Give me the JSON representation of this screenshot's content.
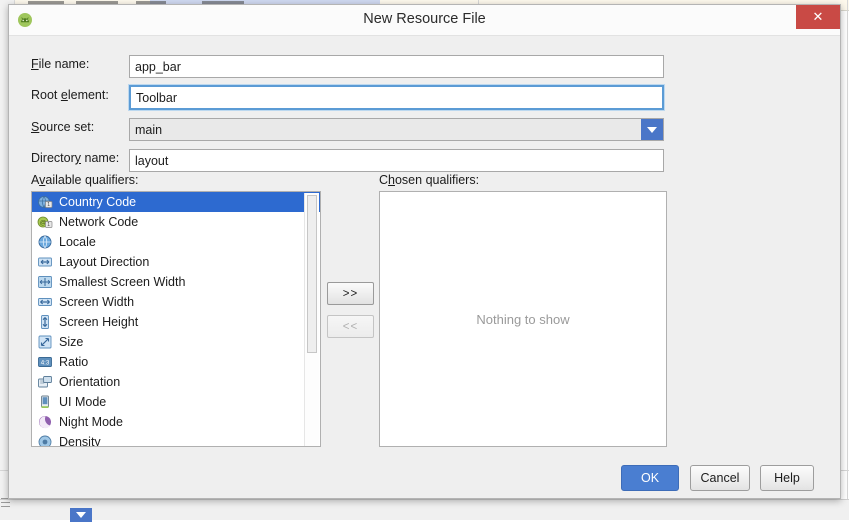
{
  "dialog": {
    "title": "New Resource File",
    "app_icon": "android-studio-icon",
    "close_label": "✕"
  },
  "form": {
    "fields": [
      {
        "label_pre": "",
        "label_mnemonic": "F",
        "label_post": "ile name:",
        "value": "app_bar",
        "type": "text",
        "focused": false
      },
      {
        "label_pre": "Root ",
        "label_mnemonic": "e",
        "label_post": "lement:",
        "value": "Toolbar",
        "type": "text",
        "focused": true
      },
      {
        "label_pre": "",
        "label_mnemonic": "S",
        "label_post": "ource set:",
        "value": "main",
        "type": "combo",
        "focused": false
      },
      {
        "label_pre": "Director",
        "label_mnemonic": "y",
        "label_post": " name:",
        "value": "layout",
        "type": "text",
        "focused": false
      }
    ]
  },
  "qualifiers": {
    "available_label_pre": "A",
    "available_label_mnemonic": "v",
    "available_label_post": "ailable qualifiers:",
    "chosen_label_pre": "C",
    "chosen_label_mnemonic": "h",
    "chosen_label_post": "osen qualifiers:",
    "available": [
      {
        "label": "Country Code",
        "icon": "globe-country-icon",
        "selected": true
      },
      {
        "label": "Network Code",
        "icon": "network-code-icon",
        "selected": false
      },
      {
        "label": "Locale",
        "icon": "globe-locale-icon",
        "selected": false
      },
      {
        "label": "Layout Direction",
        "icon": "layout-direction-icon",
        "selected": false
      },
      {
        "label": "Smallest Screen Width",
        "icon": "smallest-width-icon",
        "selected": false
      },
      {
        "label": "Screen Width",
        "icon": "screen-width-icon",
        "selected": false
      },
      {
        "label": "Screen Height",
        "icon": "screen-height-icon",
        "selected": false
      },
      {
        "label": "Size",
        "icon": "size-icon",
        "selected": false
      },
      {
        "label": "Ratio",
        "icon": "ratio-icon",
        "selected": false
      },
      {
        "label": "Orientation",
        "icon": "orientation-icon",
        "selected": false
      },
      {
        "label": "UI Mode",
        "icon": "ui-mode-icon",
        "selected": false
      },
      {
        "label": "Night Mode",
        "icon": "night-mode-icon",
        "selected": false
      },
      {
        "label": "Density",
        "icon": "density-icon",
        "selected": false
      }
    ],
    "add_button": ">>",
    "remove_button": "<<",
    "empty_text": "Nothing to show"
  },
  "actions": {
    "ok": "OK",
    "cancel": "Cancel",
    "help": "Help"
  },
  "colors": {
    "accent_blue": "#4a7ed1",
    "selection_blue": "#2d6ad0",
    "close_red": "#c94a45",
    "dialog_bg": "#efefef"
  }
}
